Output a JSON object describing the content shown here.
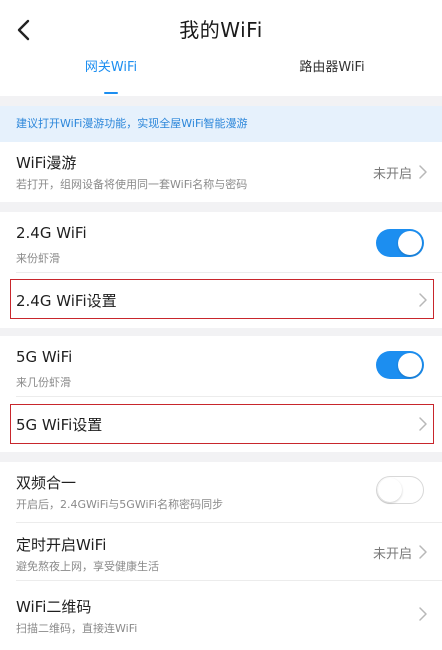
{
  "header": {
    "title": "我的WiFi",
    "tabs": [
      {
        "label": "网关WiFi",
        "active": true
      },
      {
        "label": "路由器WiFi",
        "active": false
      }
    ]
  },
  "banner": {
    "text": "建议打开WiFi漫游功能，实现全屋WiFi智能漫游"
  },
  "rows": {
    "roaming": {
      "title": "WiFi漫游",
      "subtitle": "若打开，组网设备将使用同一套WiFi名称与密码",
      "value": "未开启"
    },
    "wifi24": {
      "title": "2.4G WiFi",
      "subtitle": "来份虾滑",
      "enabled": true
    },
    "wifi24_settings": {
      "title": "2.4G WiFi设置"
    },
    "wifi5": {
      "title": "5G WiFi",
      "subtitle": "来几份虾滑",
      "enabled": true
    },
    "wifi5_settings": {
      "title": "5G WiFi设置"
    },
    "dualband": {
      "title": "双频合一",
      "subtitle": "开启后，2.4GWiFi与5GWiFi名称密码同步",
      "enabled": false
    },
    "schedule": {
      "title": "定时开启WiFi",
      "subtitle": "避免熬夜上网，享受健康生活",
      "value": "未开启"
    },
    "qrcode": {
      "title": "WiFi二维码",
      "subtitle": "扫描二维码，直接连WiFi"
    }
  },
  "colors": {
    "accent": "#1c8ef0",
    "highlight_border": "#c8262c",
    "banner_bg": "#e6f1fc"
  },
  "icons": [
    "back-arrow-icon",
    "chevron-right-icon"
  ]
}
